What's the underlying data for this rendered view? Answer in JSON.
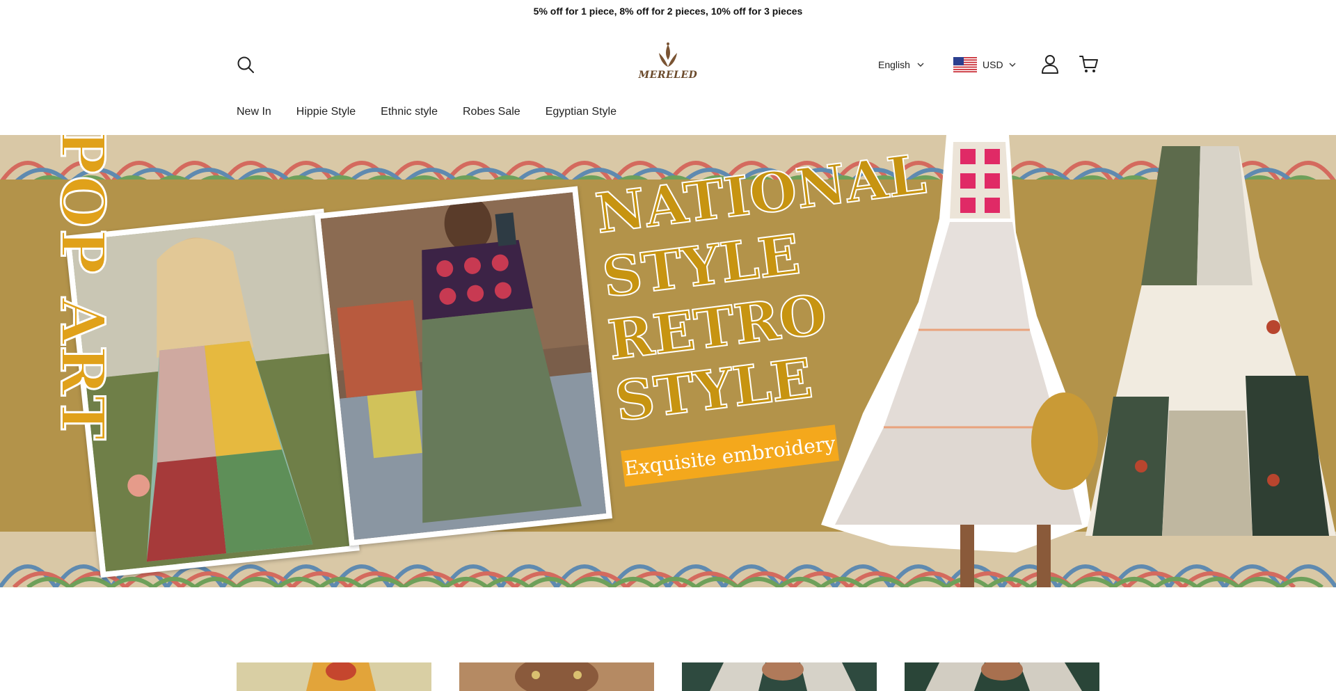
{
  "announcement": {
    "text": "5% off for 1 piece, 8% off for 2 pieces, 10% off for 3 pieces"
  },
  "header": {
    "logo_text": "MERELED",
    "language": "English",
    "currency": "USD",
    "icons": {
      "search": "search-icon",
      "account": "account-icon",
      "cart": "cart-icon",
      "flag": "us-flag-icon",
      "chevron": "chevron-down-icon"
    }
  },
  "nav": {
    "items": [
      {
        "label": "New In"
      },
      {
        "label": "Hippie Style"
      },
      {
        "label": "Ethnic style"
      },
      {
        "label": "Robes Sale"
      },
      {
        "label": "Egyptian Style"
      }
    ]
  },
  "hero": {
    "vertical_text": "POP ART",
    "headline_lines": [
      "NATIONAL",
      "STYLE",
      "RETRO",
      "STYLE"
    ],
    "tag": "Exquisite embroidery",
    "colors": {
      "background": "#b3934a",
      "headline": "#c79411",
      "tag": "#f4a81c"
    }
  }
}
